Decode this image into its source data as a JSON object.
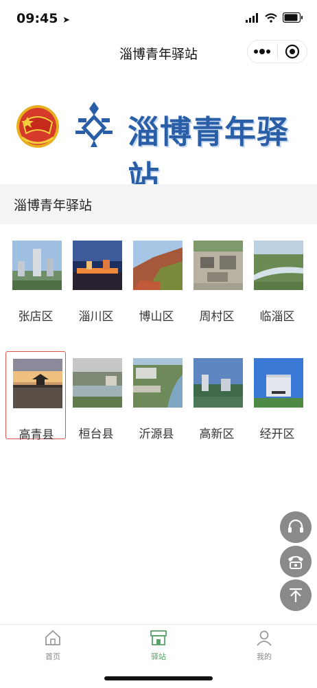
{
  "status_bar": {
    "time": "09:45"
  },
  "nav": {
    "title": "淄博青年驿站"
  },
  "banner": {
    "title": "淄博青年驿站"
  },
  "section": {
    "title": "淄博青年驿站"
  },
  "districts": [
    {
      "name": "张店区"
    },
    {
      "name": "淄川区"
    },
    {
      "name": "博山区"
    },
    {
      "name": "周村区"
    },
    {
      "name": "临淄区"
    },
    {
      "name": "高青县"
    },
    {
      "name": "桓台县"
    },
    {
      "name": "沂源县"
    },
    {
      "name": "高新区"
    },
    {
      "name": "经开区"
    }
  ],
  "selected_district": "高青县",
  "tabbar": {
    "items": [
      {
        "label": "首页",
        "icon": "home-icon"
      },
      {
        "label": "驿站",
        "icon": "station-icon"
      },
      {
        "label": "我的",
        "icon": "user-icon"
      }
    ],
    "active": "驿站"
  },
  "colors": {
    "accent_green": "#5aa26a",
    "selection_red": "#d9534f",
    "banner_blue": "#2a5fa8",
    "fab_gray": "#8a8a8a"
  }
}
